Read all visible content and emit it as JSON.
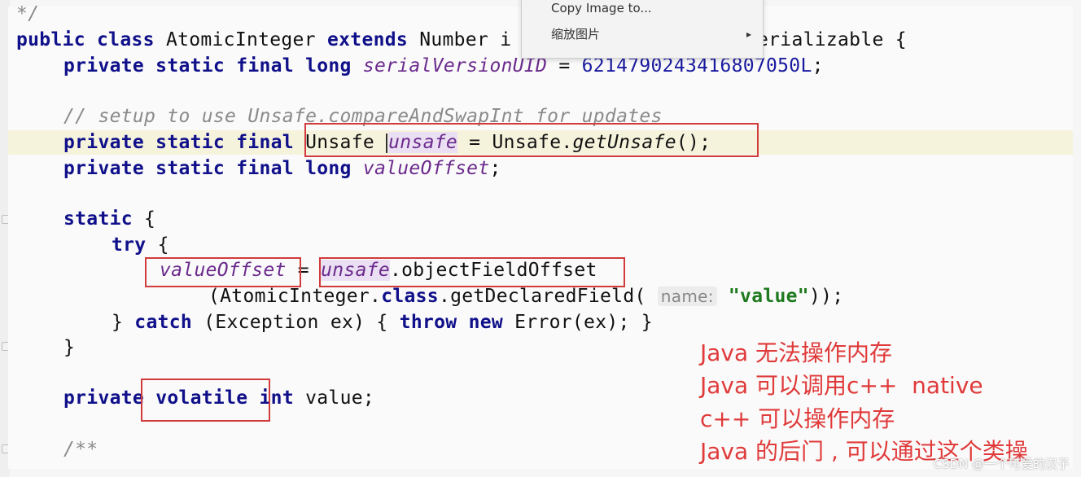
{
  "code": {
    "l_comment_end": "*/",
    "l_class": {
      "k1": "public class",
      "cls": "AtomicInteger",
      "k2": "extends",
      "rest_a": "Number i",
      "rest_b": "erializable {"
    },
    "l_serial": {
      "k": "private static final long",
      "field": "serialVersionUID",
      "eq": " = ",
      "num": "6214790243416807050L",
      "end": ";"
    },
    "l_setup_comment": "// setup to use Unsafe.compareAndSwapInt for updates",
    "l_unsafe": {
      "k": "private static final",
      "type": "Unsafe ",
      "field": "unsafe",
      "mid": " = Unsafe.",
      "call": "getUnsafe",
      "end": "();"
    },
    "l_offset": {
      "k": "private static final long",
      "field": "valueOffset",
      "end": ";"
    },
    "l_static": {
      "k": "static",
      "end": " {"
    },
    "l_try": {
      "k": "try",
      "end": " {"
    },
    "l_assign": {
      "field": "valueOffset",
      "eq": " = ",
      "field2": "unsafe",
      "rest": ".objectFieldOffset"
    },
    "l_getfield": {
      "a": "(AtomicInteger.",
      "k": "class",
      "b": ".getDeclaredField(",
      "hint": "name:",
      "str": "\"value\"",
      "end": "));"
    },
    "l_catch": {
      "a": "} ",
      "k1": "catch",
      "b": " (Exception ex) { ",
      "k2": "throw new",
      "c": " Error(ex); }"
    },
    "l_close": "}",
    "l_volatile": {
      "k1": "private",
      "k2": "volatile",
      "k3": "int",
      "rest": " value;"
    },
    "l_doc": "/**"
  },
  "context_menu": {
    "item1": "Copy Image to...",
    "item2": "缩放图片",
    "item2_arrow": "▸"
  },
  "notes": [
    "Java 无法操作内存",
    "Java 可以调用c++  native",
    "c++ 可以操作内存",
    "Java 的后门 , 可以通过这个类操"
  ],
  "watermark": "CSDN @一个可爱的汉子",
  "colors": {
    "keyword": "#10108a",
    "field": "#6b2a8c",
    "annotation_red": "#e03a3a"
  }
}
